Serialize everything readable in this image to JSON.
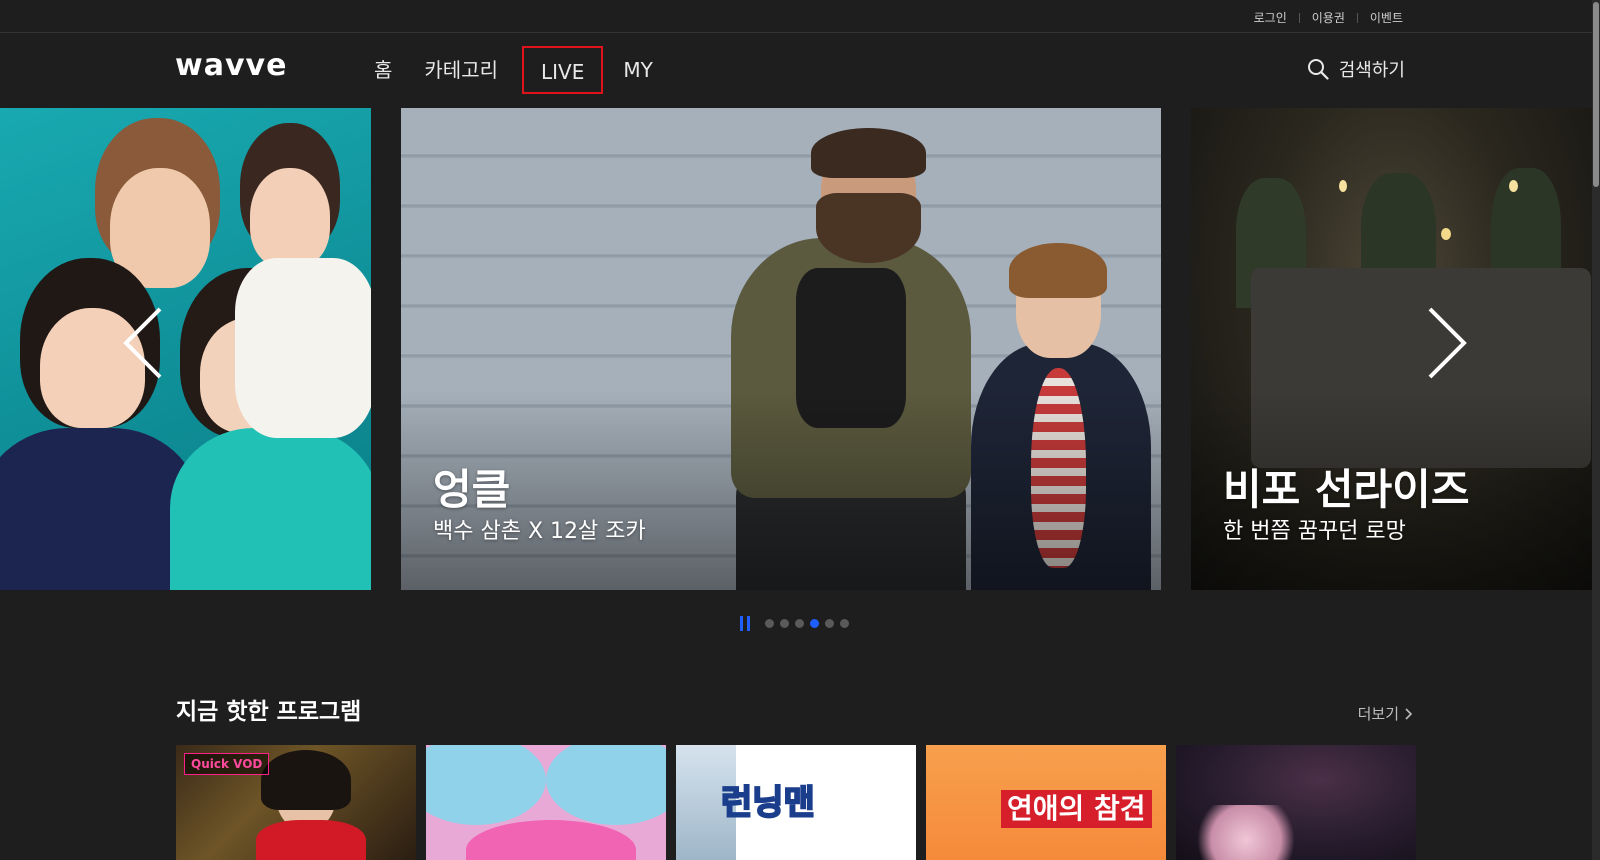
{
  "utility": {
    "links": [
      "로그인",
      "이용권",
      "이벤트"
    ]
  },
  "header": {
    "logo": "wavve",
    "nav": [
      "홈",
      "카테고리",
      "LIVE",
      "MY"
    ],
    "search_label": "검색하기"
  },
  "carousel": {
    "slides": [
      {
        "title": "",
        "subtitle": ""
      },
      {
        "title": "엉클",
        "subtitle": "백수 삼촌 X 12살 조카"
      },
      {
        "title": "비포 선라이즈",
        "subtitle": "한 번쯤 꿈꾸던 로망"
      }
    ],
    "dots_total": 6,
    "active_dot_index": 3
  },
  "section": {
    "title": "지금 핫한 프로그램",
    "more_label": "더보기",
    "thumbnails": [
      {
        "badge": "Quick VOD",
        "name": ""
      },
      {
        "badge": "",
        "name": ""
      },
      {
        "badge": "",
        "name": "런닝맨"
      },
      {
        "badge": "",
        "name": "연애의 참견"
      },
      {
        "badge": "",
        "name": ""
      }
    ]
  },
  "colors": {
    "accent_blue": "#1f5eff",
    "highlight_red": "#e0121b",
    "quick_vod_pink": "#ff1f86",
    "background": "#1e1e1e"
  }
}
